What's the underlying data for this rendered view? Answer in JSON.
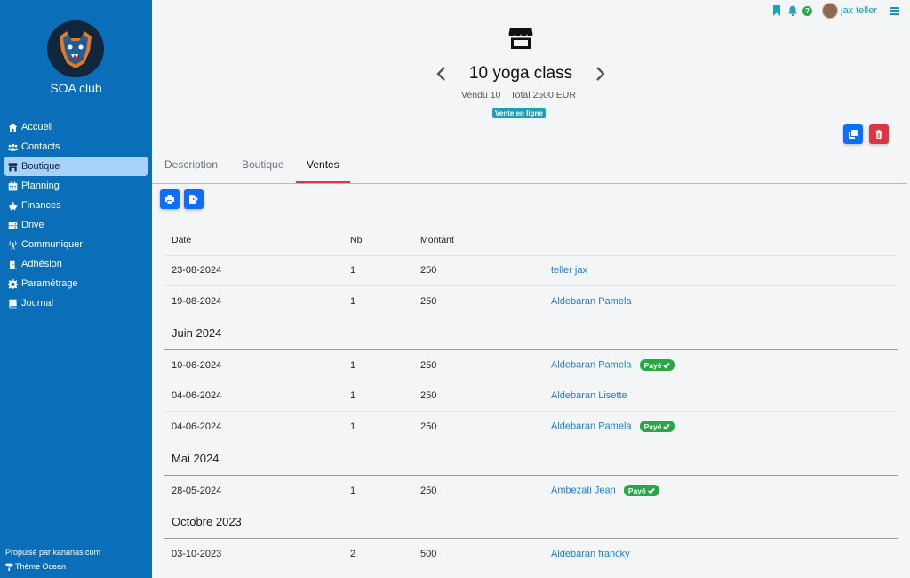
{
  "sidebar": {
    "club_name": "SOA club",
    "items": [
      {
        "label": "Accueil",
        "icon": "home-icon"
      },
      {
        "label": "Contacts",
        "icon": "users-icon"
      },
      {
        "label": "Boutique",
        "icon": "store-icon",
        "active": true
      },
      {
        "label": "Planning",
        "icon": "calendar-icon"
      },
      {
        "label": "Finances",
        "icon": "piggy-bank-icon"
      },
      {
        "label": "Drive",
        "icon": "drive-icon"
      },
      {
        "label": "Communiquer",
        "icon": "broadcast-icon"
      },
      {
        "label": "Adhésion",
        "icon": "door-icon"
      },
      {
        "label": "Paramétrage",
        "icon": "gear-icon"
      },
      {
        "label": "Journal",
        "icon": "book-icon"
      }
    ],
    "footer_powered": "Propulsé par kananas.com",
    "footer_theme": "Thème Ocean"
  },
  "topbar": {
    "user_name": "jax teller",
    "help_label": "?"
  },
  "product": {
    "title": "10 yoga class",
    "sold": "Vendu 10",
    "total": "Total 2500 EUR",
    "badge": "Vente en ligne"
  },
  "tabs": [
    "Description",
    "Boutique",
    "Ventes"
  ],
  "table": {
    "headers": {
      "date": "Date",
      "nb": "Nb",
      "montant": "Montant"
    },
    "paye_label": "Payé",
    "groups": [
      {
        "title": "",
        "rows": [
          {
            "date": "23-08-2024",
            "nb": "1",
            "montant": "250",
            "client": "teller jax",
            "paye": false
          },
          {
            "date": "19-08-2024",
            "nb": "1",
            "montant": "250",
            "client": "Aldebaran Pamela",
            "paye": false
          }
        ]
      },
      {
        "title": "Juin 2024",
        "rows": [
          {
            "date": "10-06-2024",
            "nb": "1",
            "montant": "250",
            "client": "Aldebaran Pamela",
            "paye": true
          },
          {
            "date": "04-06-2024",
            "nb": "1",
            "montant": "250",
            "client": "Aldebaran Lisette",
            "paye": false
          },
          {
            "date": "04-06-2024",
            "nb": "1",
            "montant": "250",
            "client": "Aldebaran Pamela",
            "paye": true
          }
        ]
      },
      {
        "title": "Mai 2024",
        "rows": [
          {
            "date": "28-05-2024",
            "nb": "1",
            "montant": "250",
            "client": "Ambezati Jean",
            "paye": true
          }
        ]
      },
      {
        "title": "Octobre 2023",
        "rows": [
          {
            "date": "03-10-2023",
            "nb": "2",
            "montant": "500",
            "client": "Aldebaran francky",
            "paye": false
          }
        ]
      }
    ]
  },
  "colors": {
    "sidebar": "#0a6fb8",
    "primary": "#0d6efd",
    "danger": "#dc3545",
    "success": "#28a745",
    "info": "#17a2b8"
  }
}
